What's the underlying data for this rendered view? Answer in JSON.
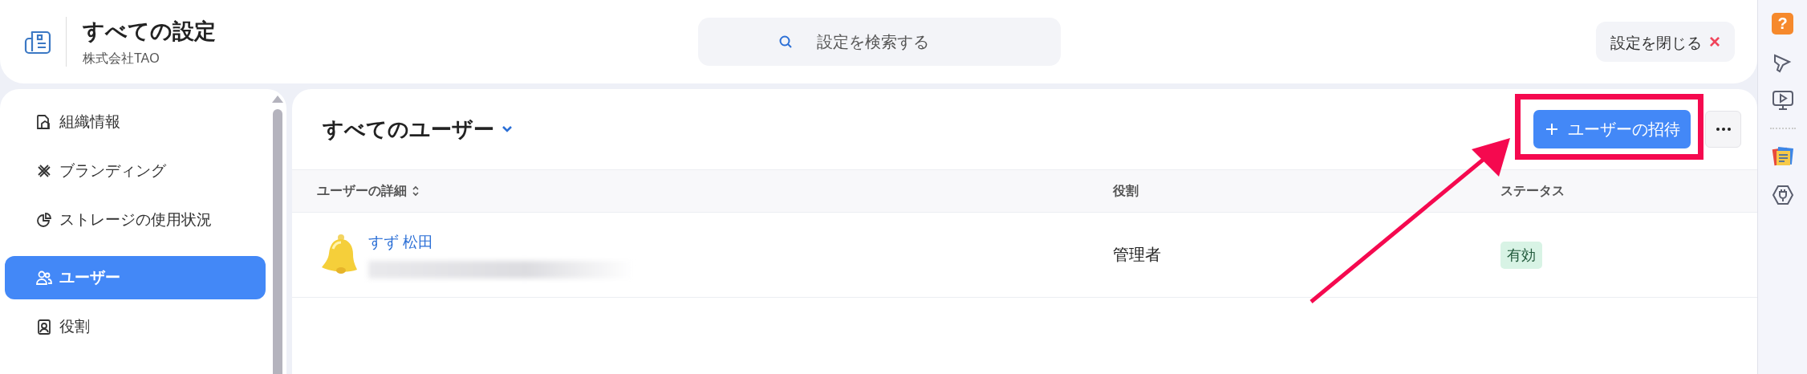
{
  "header": {
    "title": "すべての設定",
    "subtitle": "株式会社TAO"
  },
  "search": {
    "placeholder": "設定を検索する"
  },
  "close_button": {
    "label": "設定を閉じる",
    "icon": "×"
  },
  "sidebar": {
    "items": [
      {
        "label": "組織情報",
        "kind": "organization",
        "selected": false
      },
      {
        "label": "ブランディング",
        "kind": "branding",
        "selected": false
      },
      {
        "label": "ストレージの使用状況",
        "kind": "storage",
        "selected": false
      },
      {
        "label": "ユーザー",
        "kind": "users",
        "selected": true
      },
      {
        "label": "役割",
        "kind": "roles",
        "selected": false
      }
    ]
  },
  "main": {
    "title": "すべてのユーザー",
    "invite_button": "ユーザーの招待",
    "table": {
      "columns": [
        {
          "label": "ユーザーの詳細",
          "sortable": true
        },
        {
          "label": "役割",
          "sortable": false
        },
        {
          "label": "ステータス",
          "sortable": false
        }
      ],
      "rows": [
        {
          "name": "すず 松田",
          "role": "管理者",
          "status": "有効"
        }
      ]
    }
  },
  "rail": {
    "help_label": "?"
  }
}
